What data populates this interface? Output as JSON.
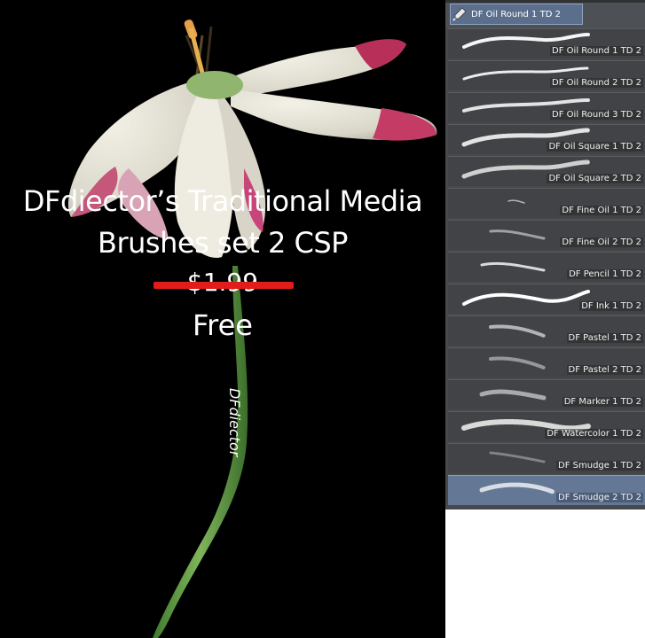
{
  "artwork": {
    "title_line1": "DFdiector’s Traditional Media",
    "title_line2": "Brushes set 2 CSP",
    "old_price": "$1.99",
    "new_price": "Free",
    "signature": "DFdiector"
  },
  "brush_panel": {
    "tab_label": "DF Oil Round 1 TD 2",
    "tab_icon": "brush-tool-icon",
    "selected_index": 14,
    "brushes": [
      {
        "label": "DF Oil Round 1 TD 2"
      },
      {
        "label": "DF Oil Round 2 TD 2"
      },
      {
        "label": "DF Oil Round 3 TD 2"
      },
      {
        "label": "DF Oil Square 1 TD 2"
      },
      {
        "label": "DF Oil Square 2 TD 2"
      },
      {
        "label": "DF Fine Oil 1 TD 2"
      },
      {
        "label": "DF Fine Oil 2 TD 2"
      },
      {
        "label": "DF Pencil 1 TD 2"
      },
      {
        "label": "DF Ink 1 TD 2"
      },
      {
        "label": "DF Pastel 1 TD 2"
      },
      {
        "label": "DF Pastel 2 TD 2"
      },
      {
        "label": "DF Marker 1 TD 2"
      },
      {
        "label": "DF Watercolor 1 TD 2"
      },
      {
        "label": "DF Smudge 1 TD 2"
      },
      {
        "label": "DF Smudge 2 TD 2"
      }
    ]
  },
  "colors": {
    "canvas_bg": "#000000",
    "panel_bg": "#47494c",
    "selected_row": "#647896",
    "strike_red": "#e21b1b"
  }
}
